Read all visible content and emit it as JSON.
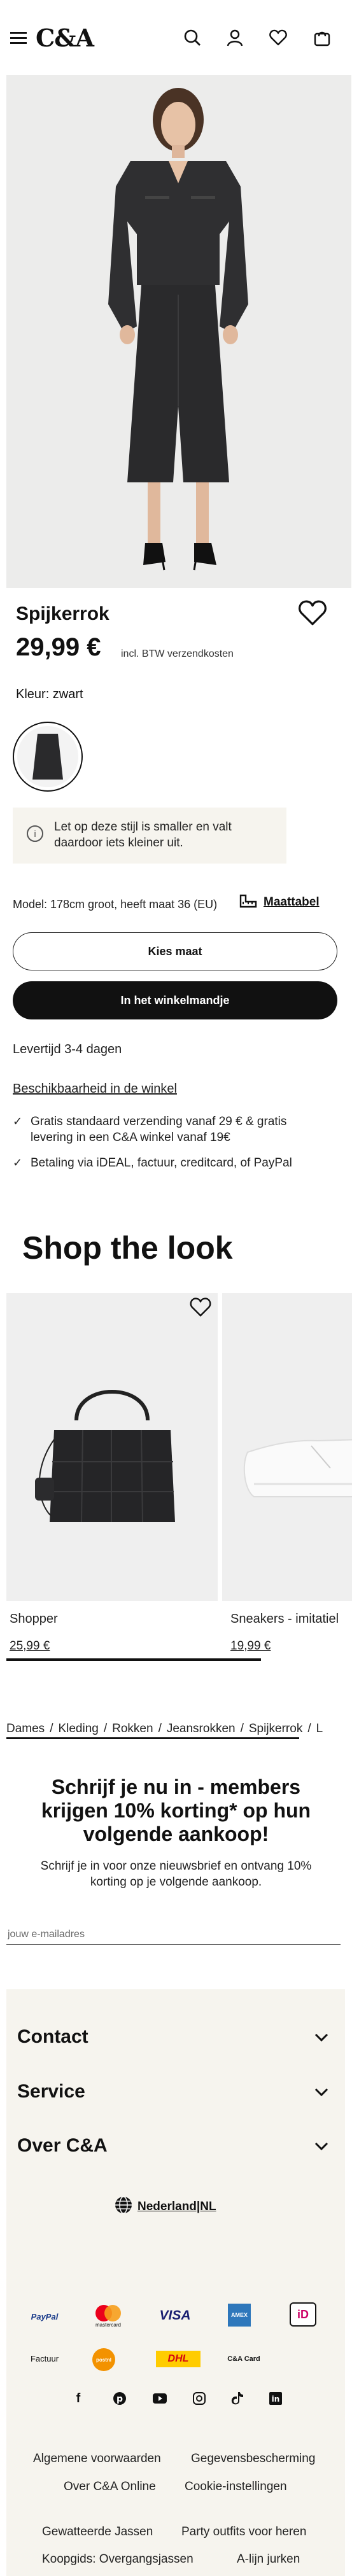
{
  "header": {
    "logo": "C&A",
    "icons": [
      "menu-icon",
      "search-icon",
      "account-icon",
      "heart-icon",
      "bag-icon"
    ]
  },
  "product": {
    "title": "Spijkerrok",
    "price": "29,99 €",
    "tax_note": "incl. BTW verzendkosten",
    "color_label": "Kleur: zwart",
    "notice": "Let op deze stijl is smaller en valt daardoor iets kleiner uit.",
    "model_info": "Model: 178cm groot, heeft maat 36 (EU)",
    "size_table": "Maattabel",
    "choose_size": "Kies maat",
    "add_to_cart": "In het winkelmandje",
    "delivery": "Levertijd 3-4 dagen",
    "availability": "Beschikbaarheid in de winkel",
    "usps": [
      "Gratis standaard verzending vanaf 29 € & gratis levering in een C&A winkel vanaf 19€",
      "Betaling via iDEAL, factuur, creditcard, of PayPal"
    ]
  },
  "shop_the_look": {
    "title": "Shop the look",
    "items": [
      {
        "name": "Shopper",
        "price": "25,99 €"
      },
      {
        "name": "Sneakers - imitatiel",
        "price": "19,99 €"
      }
    ]
  },
  "breadcrumb": [
    "Dames",
    "Kleding",
    "Rokken",
    "Jeansrokken",
    "Spijkerrok",
    "L"
  ],
  "newsletter": {
    "title": "Schrijf je nu in - members krijgen 10% korting* op hun volgende aankoop!",
    "text": "Schrijf je in voor onze nieuwsbrief en ontvang 10% korting op je volgende aankoop.",
    "placeholder": "jouw e-mailadres"
  },
  "footer": {
    "accordions": [
      "Contact",
      "Service",
      "Over C&A"
    ],
    "locale": "Nederland|NL",
    "payments": {
      "paypal": "PayPal",
      "mastercard": "mastercard",
      "visa": "VISA",
      "amex": "AMEX",
      "ideal": "iD",
      "factuur": "Factuur",
      "postnl": "postnl",
      "dhl": "DHL",
      "ca_card": "C&A Card"
    },
    "social_icons": [
      "facebook-icon",
      "pinterest-icon",
      "youtube-icon",
      "instagram-icon",
      "tiktok-icon",
      "linkedin-icon"
    ],
    "links": {
      "terms": "Algemene voorwaarden",
      "privacy": "Gegevensbescherming",
      "about": "Over C&A Online",
      "cookies": "Cookie-instellingen",
      "jeans": "Gewatteerde Jassen",
      "party": "Party outfits voor heren",
      "guide": "Koopgids: Overgangsjassen",
      "skirt": "A-lijn jurken"
    }
  }
}
